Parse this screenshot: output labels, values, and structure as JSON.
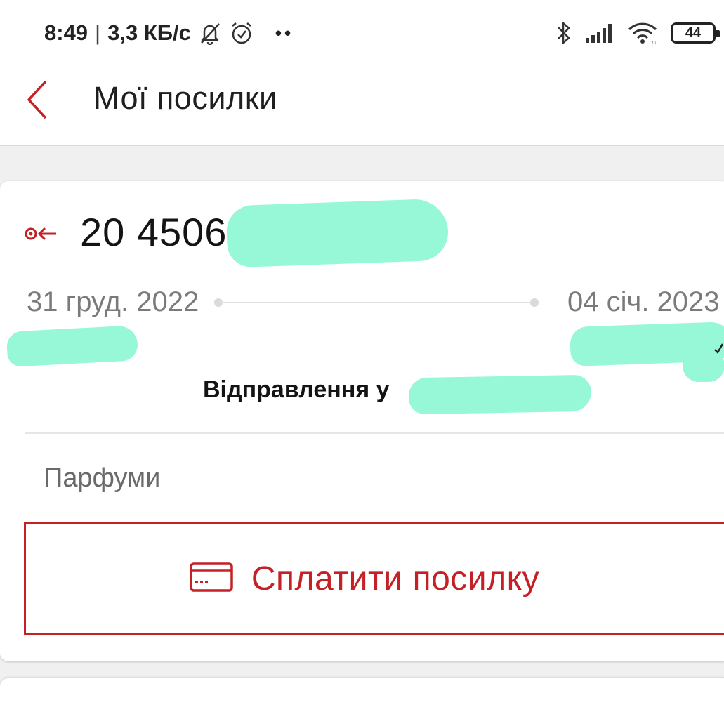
{
  "status_bar": {
    "time": "8:49",
    "separator": "|",
    "network_speed": "3,3 КБ/с",
    "dots": "••",
    "battery_level": "44",
    "icons": [
      "bell-off-icon",
      "alarm-icon",
      "bluetooth-icon",
      "signal-icon",
      "wifi-icon",
      "battery-icon"
    ]
  },
  "header": {
    "title": "Мої посилки",
    "back_icon": "chevron-left-icon"
  },
  "parcel": {
    "direction_icon": "incoming-parcel-icon",
    "tracking_number_visible": "20 4506",
    "date_sent": "31 груд. 2022",
    "date_arrival": "04 січ. 2023",
    "status_text": "Відправлення у",
    "description": "Парфуми",
    "pay_button_label": "Сплатити посилку",
    "pay_icon": "credit-card-icon"
  },
  "colors": {
    "accent": "#c42026",
    "redaction": "#96f8d7",
    "background": "#f0f0f0"
  }
}
